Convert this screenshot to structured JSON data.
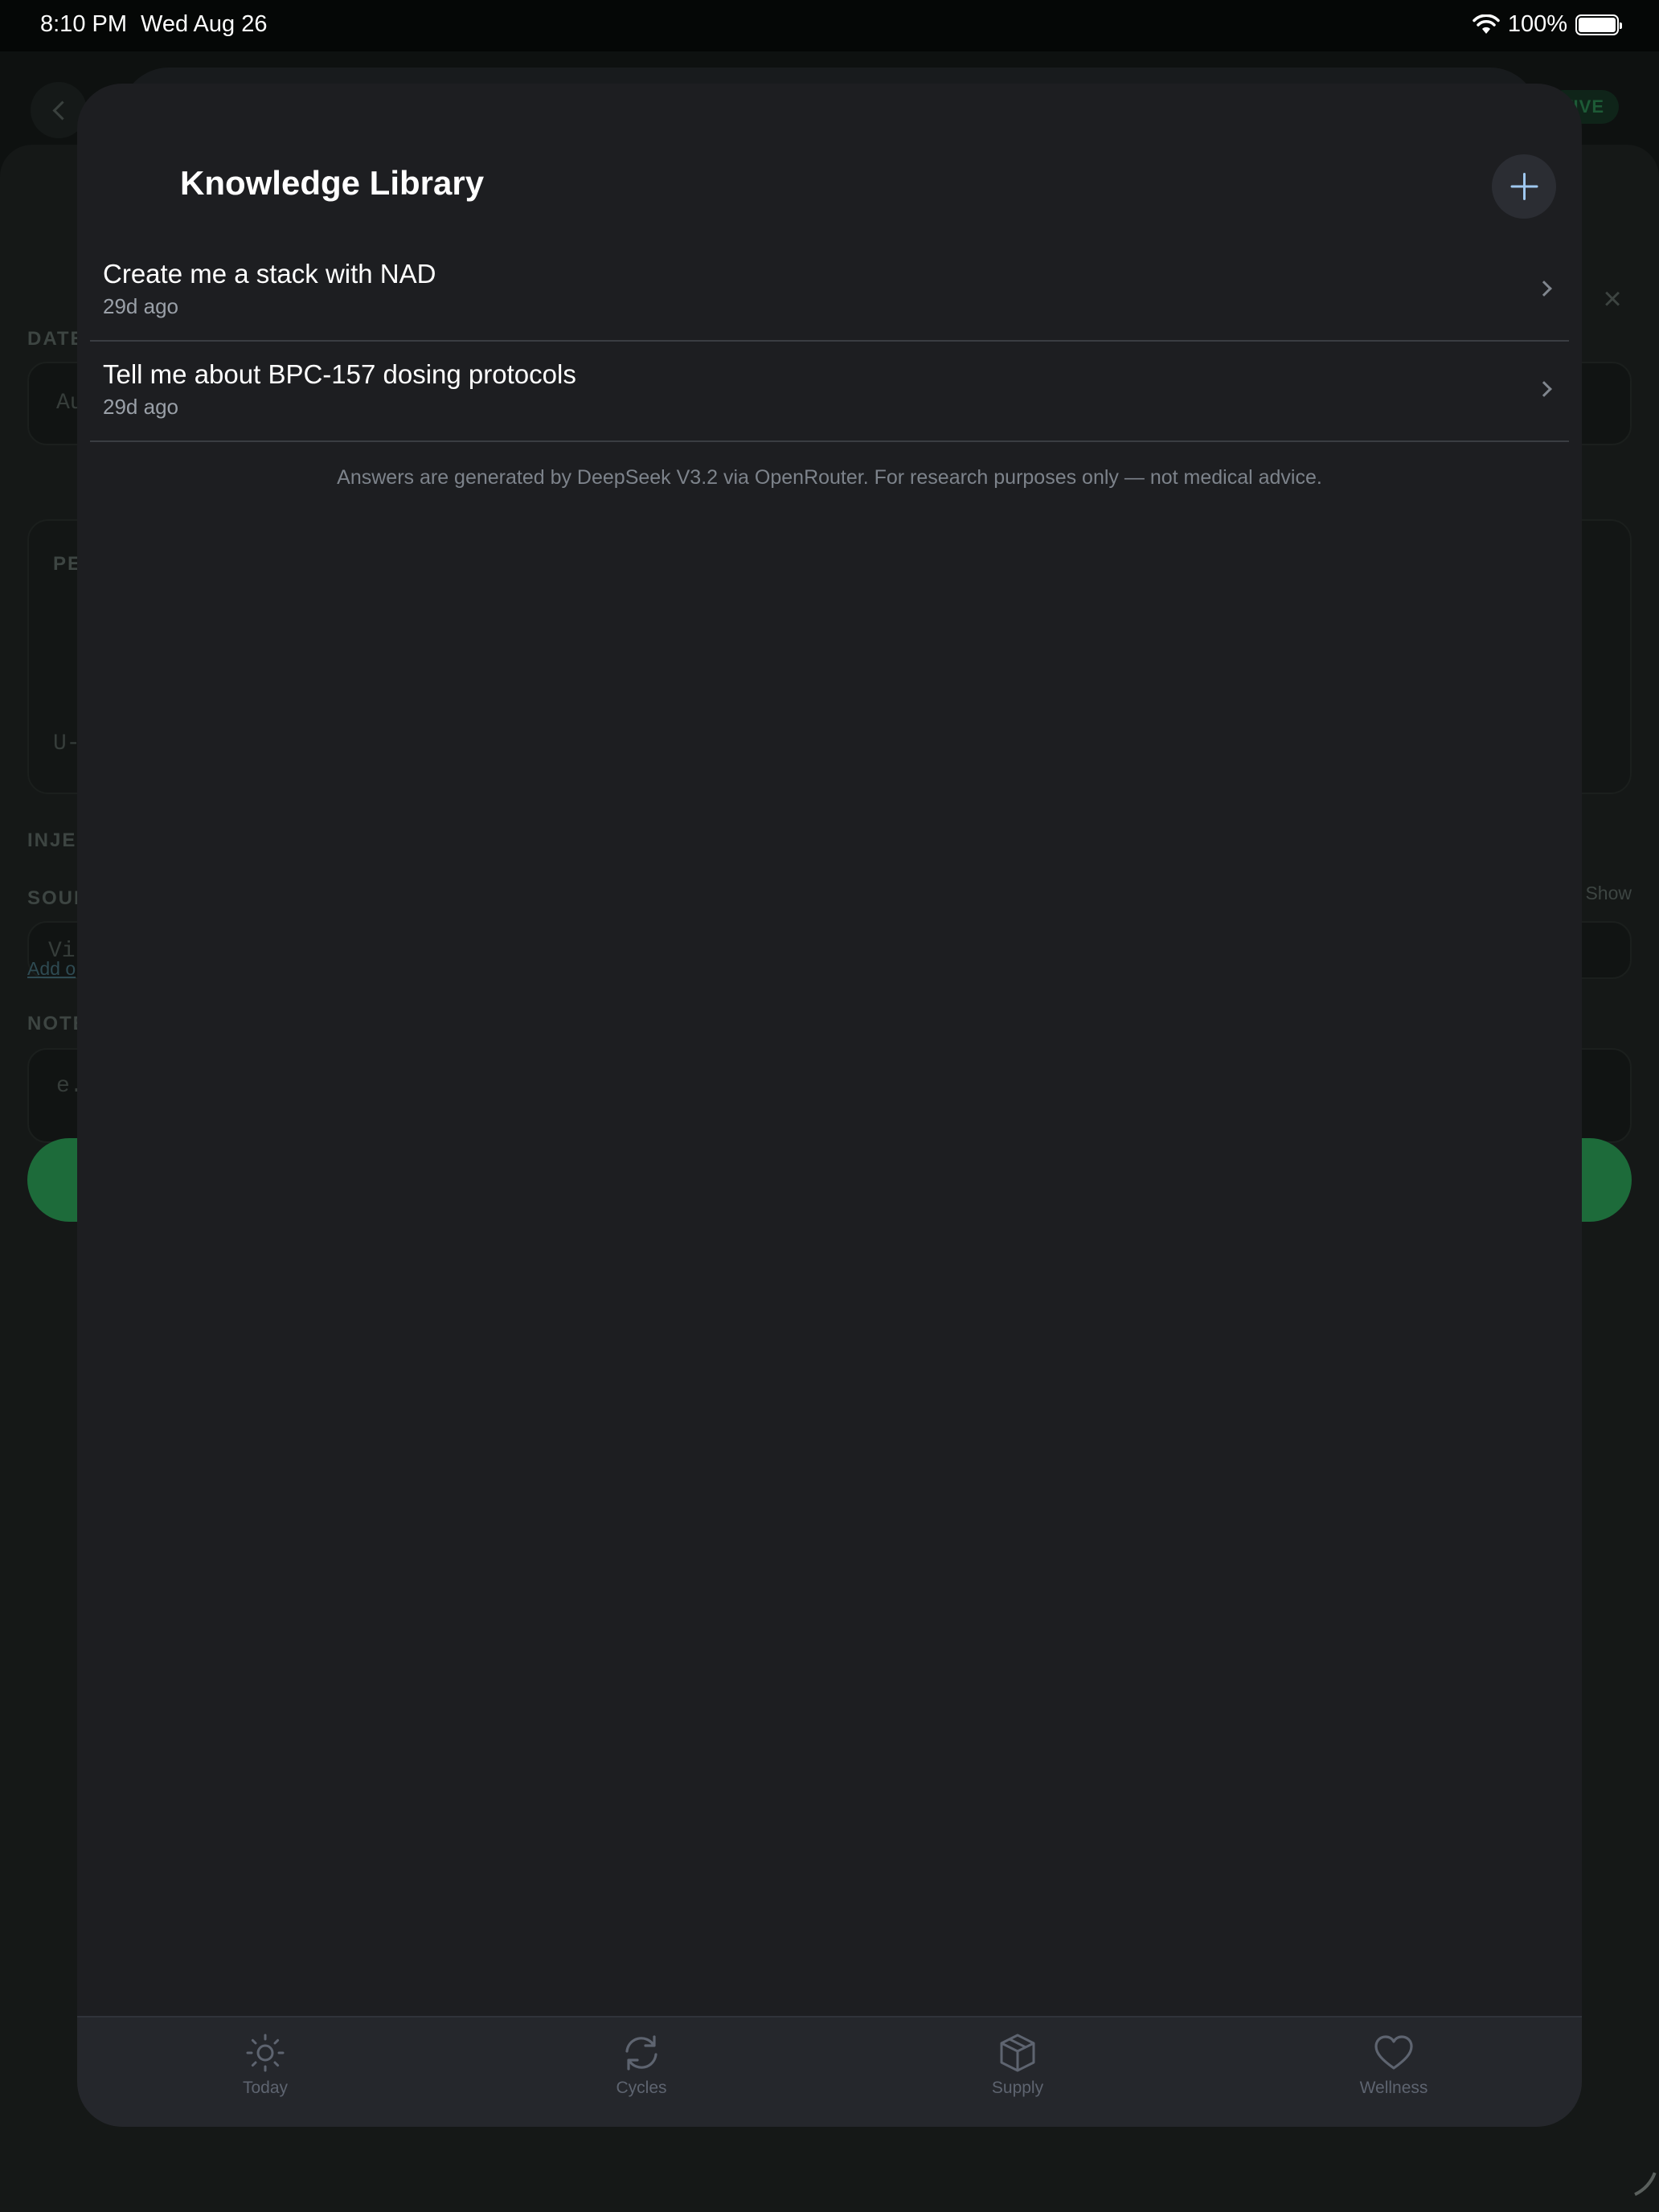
{
  "status_bar": {
    "time": "8:10 PM",
    "date": "Wed Aug 26",
    "battery": "100%"
  },
  "background": {
    "badge": "TIVE",
    "labels": [
      "DATE",
      "PE",
      "INJE",
      "SOUR",
      "NOTE"
    ],
    "field_texts": [
      "Au",
      "U-1",
      "Vi",
      "e.("
    ],
    "show_label": "Show",
    "add_link": "Add o"
  },
  "modal": {
    "title": "Knowledge Library",
    "items": [
      {
        "title": "Create me a stack with NAD",
        "time": "29d ago"
      },
      {
        "title": "Tell me about BPC-157 dosing protocols",
        "time": "29d ago"
      }
    ],
    "disclaimer": "Answers are generated by DeepSeek V3.2 via OpenRouter. For research purposes only — not medical advice."
  },
  "tabs": [
    {
      "label": "Today",
      "icon": "sun-icon"
    },
    {
      "label": "Cycles",
      "icon": "refresh-icon"
    },
    {
      "label": "Supply",
      "icon": "box-icon"
    },
    {
      "label": "Wellness",
      "icon": "heart-icon"
    }
  ],
  "colors": {
    "modal_bg": "#1d1e21",
    "accent_plus": "#9fc8f0",
    "tab_inactive": "#5e6470"
  }
}
